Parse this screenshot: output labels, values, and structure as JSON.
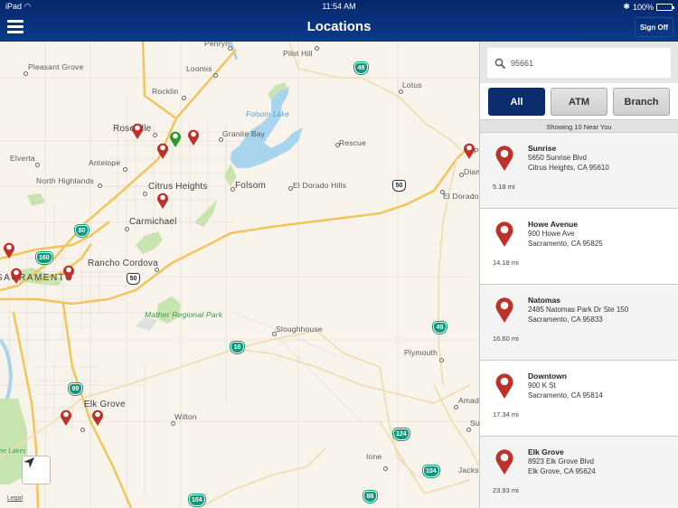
{
  "status_bar": {
    "device": "iPad",
    "time": "11:54 AM",
    "battery": "100%"
  },
  "header": {
    "title": "Locations",
    "sign_off_label": "Sign Off",
    "menu_icon": "hamburger-menu-icon",
    "color": "#0a3480"
  },
  "map": {
    "places": [
      {
        "label": "Pleasant Grove"
      },
      {
        "label": "Penryn"
      },
      {
        "label": "Pilot Hill"
      },
      {
        "label": "Loomis"
      },
      {
        "label": "Rocklin"
      },
      {
        "label": "Lotus"
      },
      {
        "label": "Roseville"
      },
      {
        "label": "Granite Bay"
      },
      {
        "label": "Rescue"
      },
      {
        "label": "Elverta"
      },
      {
        "label": "Antelope"
      },
      {
        "label": "North Highlands"
      },
      {
        "label": "Citrus Heights"
      },
      {
        "label": "Folsom"
      },
      {
        "label": "El Dorado Hills"
      },
      {
        "label": "Carmichael"
      },
      {
        "label": "Rancho Cordova"
      },
      {
        "label": "SACRAMENTO"
      },
      {
        "label": "Sloughhouse"
      },
      {
        "label": "Plymouth"
      },
      {
        "label": "Elk Grove"
      },
      {
        "label": "Wilton"
      },
      {
        "label": "Amad"
      },
      {
        "label": "Su"
      },
      {
        "label": "Ione"
      },
      {
        "label": "Jacks"
      },
      {
        "label": "Diam"
      },
      {
        "label": "El Dorado"
      },
      {
        "label": "P"
      }
    ],
    "lake_label": "Folsom Lake",
    "park_labels": [
      "Mather Regional Park",
      "Stone Lakes National Wildlife Refuge"
    ],
    "highways": [
      "49",
      "50",
      "80",
      "160",
      "50",
      "16",
      "49",
      "99",
      "124",
      "104",
      "104",
      "88",
      "16"
    ],
    "pin_colors": {
      "branch": "#c0302a",
      "current": "#2a9a2a"
    },
    "legal_label": "Legal",
    "locate_icon": "location-arrow-icon"
  },
  "panel": {
    "search": {
      "value": "95661",
      "icon": "search-icon"
    },
    "filters": [
      {
        "label": "All",
        "active": true
      },
      {
        "label": "ATM",
        "active": false
      },
      {
        "label": "Branch",
        "active": false
      }
    ],
    "showing_text": "Showing 10 Near You",
    "locations": [
      {
        "name": "Sunrise",
        "address1": "5650 Sunrise Blvd",
        "address2": "Citrus Heights, CA 95610",
        "distance": "5.18 mi"
      },
      {
        "name": "Howe Avenue",
        "address1": "900 Howe Ave",
        "address2": "Sacramento, CA 95825",
        "distance": "14.18 mi"
      },
      {
        "name": "Natomas",
        "address1": "2485 Natomas Park Dr Ste 150",
        "address2": "Sacramento, CA 95833",
        "distance": "16.60 mi"
      },
      {
        "name": "Downtown",
        "address1": "900 K St",
        "address2": "Sacramento, CA 95814",
        "distance": "17.34 mi"
      },
      {
        "name": "Elk Grove",
        "address1": "8923 Elk Grove Blvd",
        "address2": "Elk Grove, CA 95624",
        "distance": "23.93 mi"
      }
    ]
  }
}
